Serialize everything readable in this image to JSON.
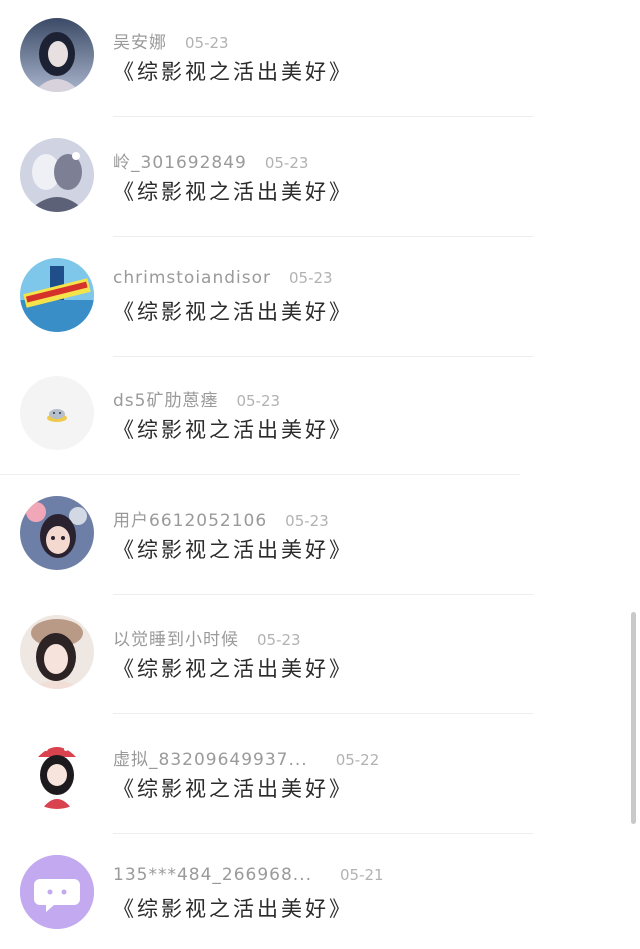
{
  "colors": {
    "divider": "#ededed",
    "username": "#9a9a9a",
    "message": "#2b2b2b"
  },
  "items": [
    {
      "username": "吴安娜",
      "date": "05-23",
      "message": "《综影视之活出美好》",
      "avatar": "anime-girl-night-avatar"
    },
    {
      "username": "岭_301692849",
      "date": "05-23",
      "message": "《综影视之活出美好》",
      "avatar": "anime-couple-avatar"
    },
    {
      "username": "chrimstoiandisor",
      "date": "05-23",
      "message": "《综影视之活出美好》",
      "avatar": "poster-avatar"
    },
    {
      "username": "ds5矿肋蒽瘗",
      "date": "05-23",
      "message": "《综影视之活出美好》",
      "avatar": "cat-sticker-avatar"
    },
    {
      "username": "用户6612052106",
      "date": "05-23",
      "message": "《综影视之活出美好》",
      "avatar": "doll-girl-avatar"
    },
    {
      "username": "以觉睡到小时候",
      "date": "05-23",
      "message": "《综影视之活出美好》",
      "avatar": "girl-hat-avatar"
    },
    {
      "username": "虚拟_83209649937...",
      "date": "05-22",
      "message": "《综影视之活出美好》",
      "avatar": "chibi-girl-avatar"
    },
    {
      "username": "135***484_266968...",
      "date": "05-21",
      "message": "《综影视之活出美好》",
      "avatar": "chat-bubble-avatar"
    }
  ]
}
